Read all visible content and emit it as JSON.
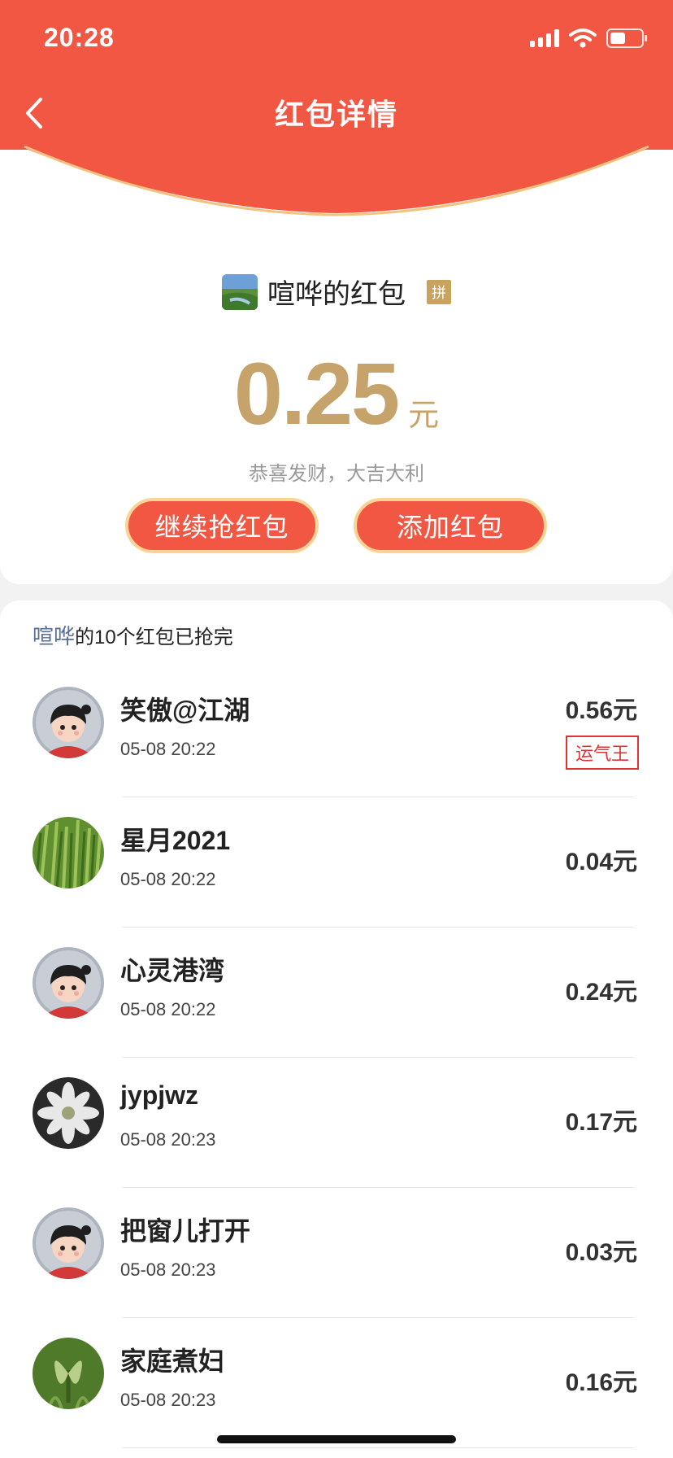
{
  "status": {
    "time": "20:28"
  },
  "nav": {
    "title": "红包详情"
  },
  "colors": {
    "header": "#f25744",
    "amount": "#c5a36a",
    "accent_border": "#f8d596",
    "sender_link": "#5a6e9b",
    "lucky": "#d33333"
  },
  "packet": {
    "sender_name": "喧哗的红包",
    "badge": "拼",
    "amount": "0.25",
    "unit": "元",
    "blessing": "恭喜发财，大吉大利",
    "buttons": {
      "continue": "继续抢红包",
      "add": "添加红包"
    }
  },
  "summary": {
    "sender": "喧哗",
    "text": "的10个红包已抢完"
  },
  "receivers": [
    {
      "name": "笑傲@江湖",
      "time": "05-08 20:22",
      "amount": "0.56元",
      "lucky": "运气王",
      "avatar": "cartoon-avatar-icon"
    },
    {
      "name": "星月2021",
      "time": "05-08 20:22",
      "amount": "0.04元",
      "avatar": "wheat-field-avatar"
    },
    {
      "name": "心灵港湾",
      "time": "05-08 20:22",
      "amount": "0.24元",
      "avatar": "cartoon-avatar-icon"
    },
    {
      "name": "jypjwz",
      "time": "05-08 20:23",
      "amount": "0.17元",
      "avatar": "white-flower-avatar"
    },
    {
      "name": "把窗儿打开",
      "time": "05-08 20:23",
      "amount": "0.03元",
      "avatar": "cartoon-avatar-icon"
    },
    {
      "name": "家庭煮妇",
      "time": "05-08 20:23",
      "amount": "0.16元",
      "avatar": "green-plant-avatar"
    }
  ]
}
